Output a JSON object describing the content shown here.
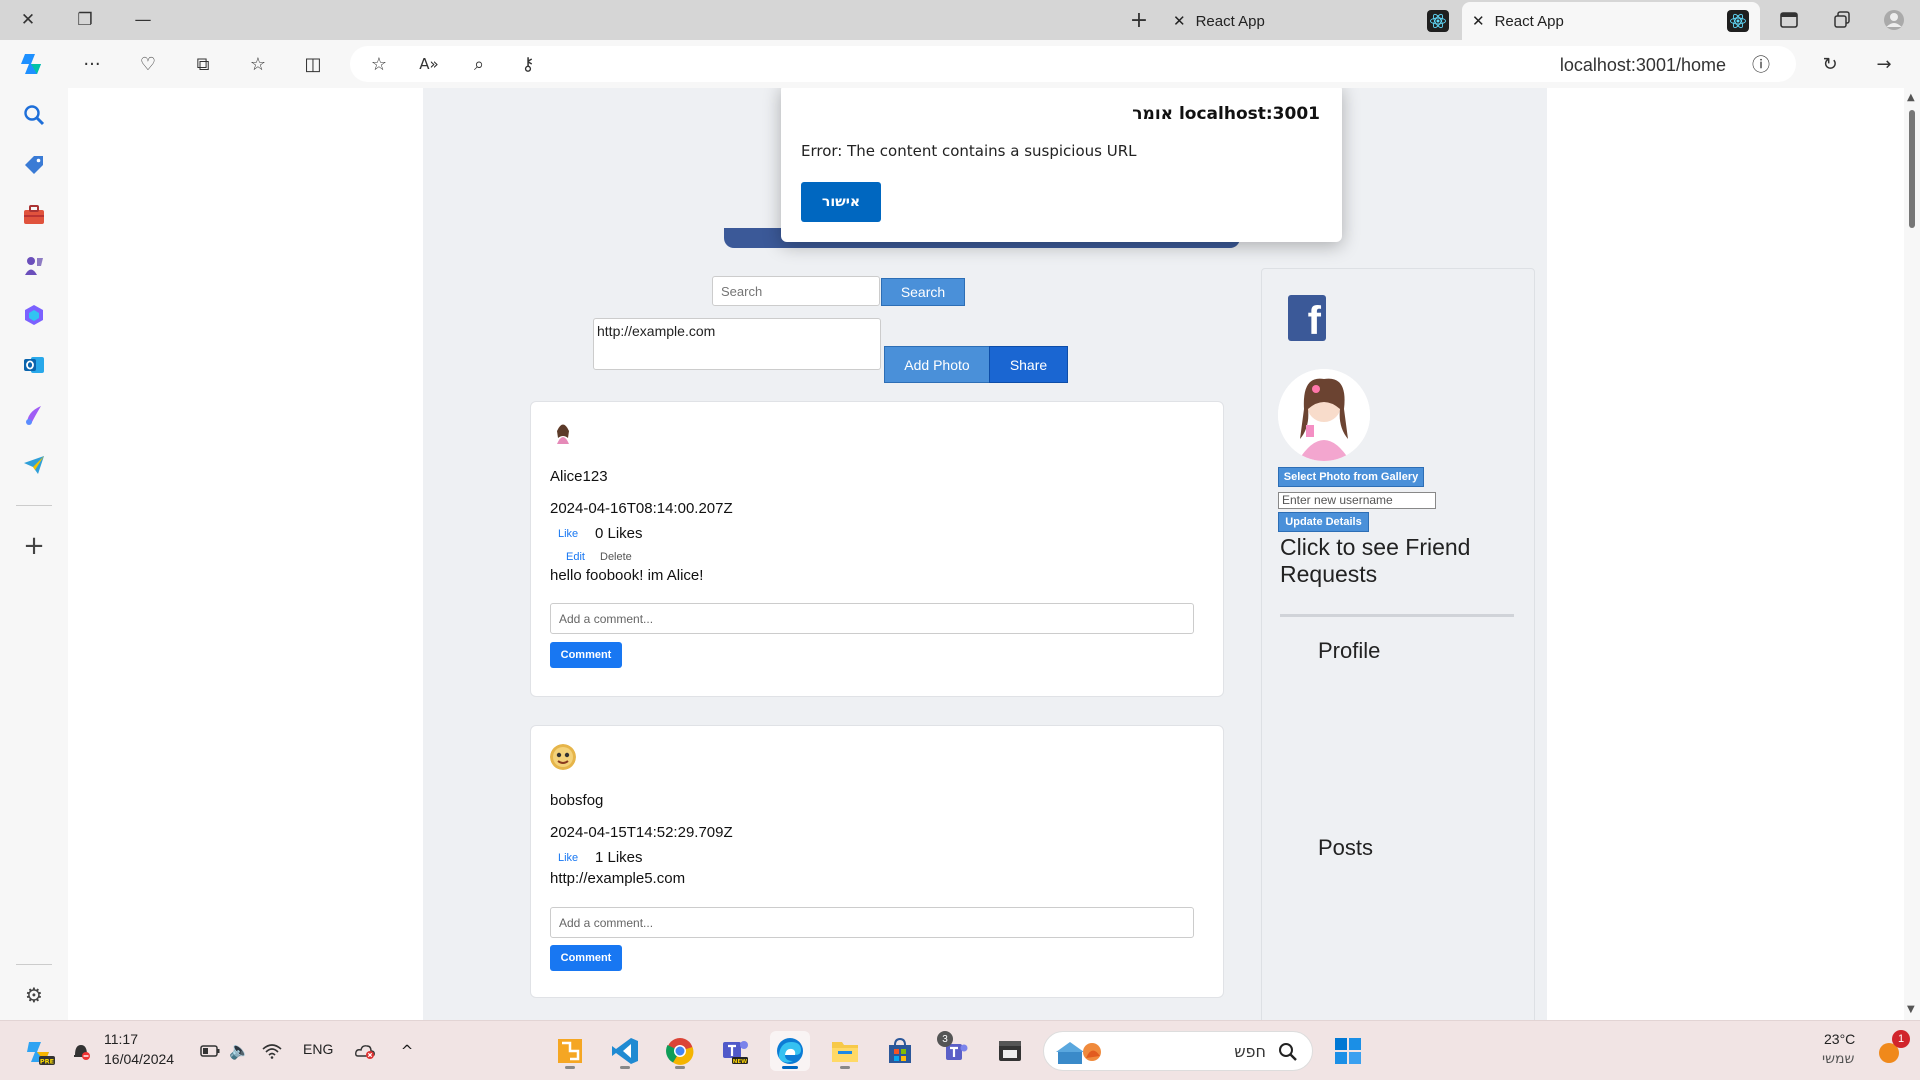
{
  "browser": {
    "tabs": [
      {
        "title": "React App",
        "active": false
      },
      {
        "title": "React App",
        "active": true
      }
    ],
    "url": "localhost:3001/home"
  },
  "alert": {
    "title": "localhost:3001 אומר",
    "message": "Error: The content contains a suspicious URL",
    "ok_label": "אישור"
  },
  "composer": {
    "search_placeholder": "Search",
    "search_button": "Search",
    "photo_url_value": "http://example.com",
    "add_photo_button": "Add Photo",
    "share_button": "Share"
  },
  "posts": [
    {
      "username": "Alice123",
      "timestamp": "2024-04-16T08:14:00.207Z",
      "like_label": "Like",
      "likes_text": "0 Likes",
      "edit_label": "Edit",
      "delete_label": "Delete",
      "content": "hello foobook! im Alice!",
      "comment_placeholder": "Add a comment...",
      "comment_button": "Comment"
    },
    {
      "username": "bobsfog",
      "timestamp": "2024-04-15T14:52:29.709Z",
      "like_label": "Like",
      "likes_text": "1 Likes",
      "content": "http://example5.com",
      "comment_placeholder": "Add a comment...",
      "comment_button": "Comment"
    }
  ],
  "profile_panel": {
    "logo_letter": "f",
    "select_photo_button": "Select Photo from Gallery",
    "username_placeholder": "Enter new username",
    "update_button": "Update Details",
    "friend_requests_text": "Click to see Friend Requests",
    "profile_heading": "Profile",
    "posts_heading": "Posts"
  },
  "taskbar": {
    "time": "11:17",
    "date": "16/04/2024",
    "language": "ENG",
    "search_placeholder": "חפש",
    "teams_badge": "3",
    "weather_temp": "23°C",
    "weather_desc": "שמשי",
    "notification_count": "1"
  },
  "colors": {
    "facebook_blue": "#3b5998",
    "button_blue": "#4a90d9",
    "comment_blue": "#1877f2",
    "dialog_button": "#0067c0"
  }
}
